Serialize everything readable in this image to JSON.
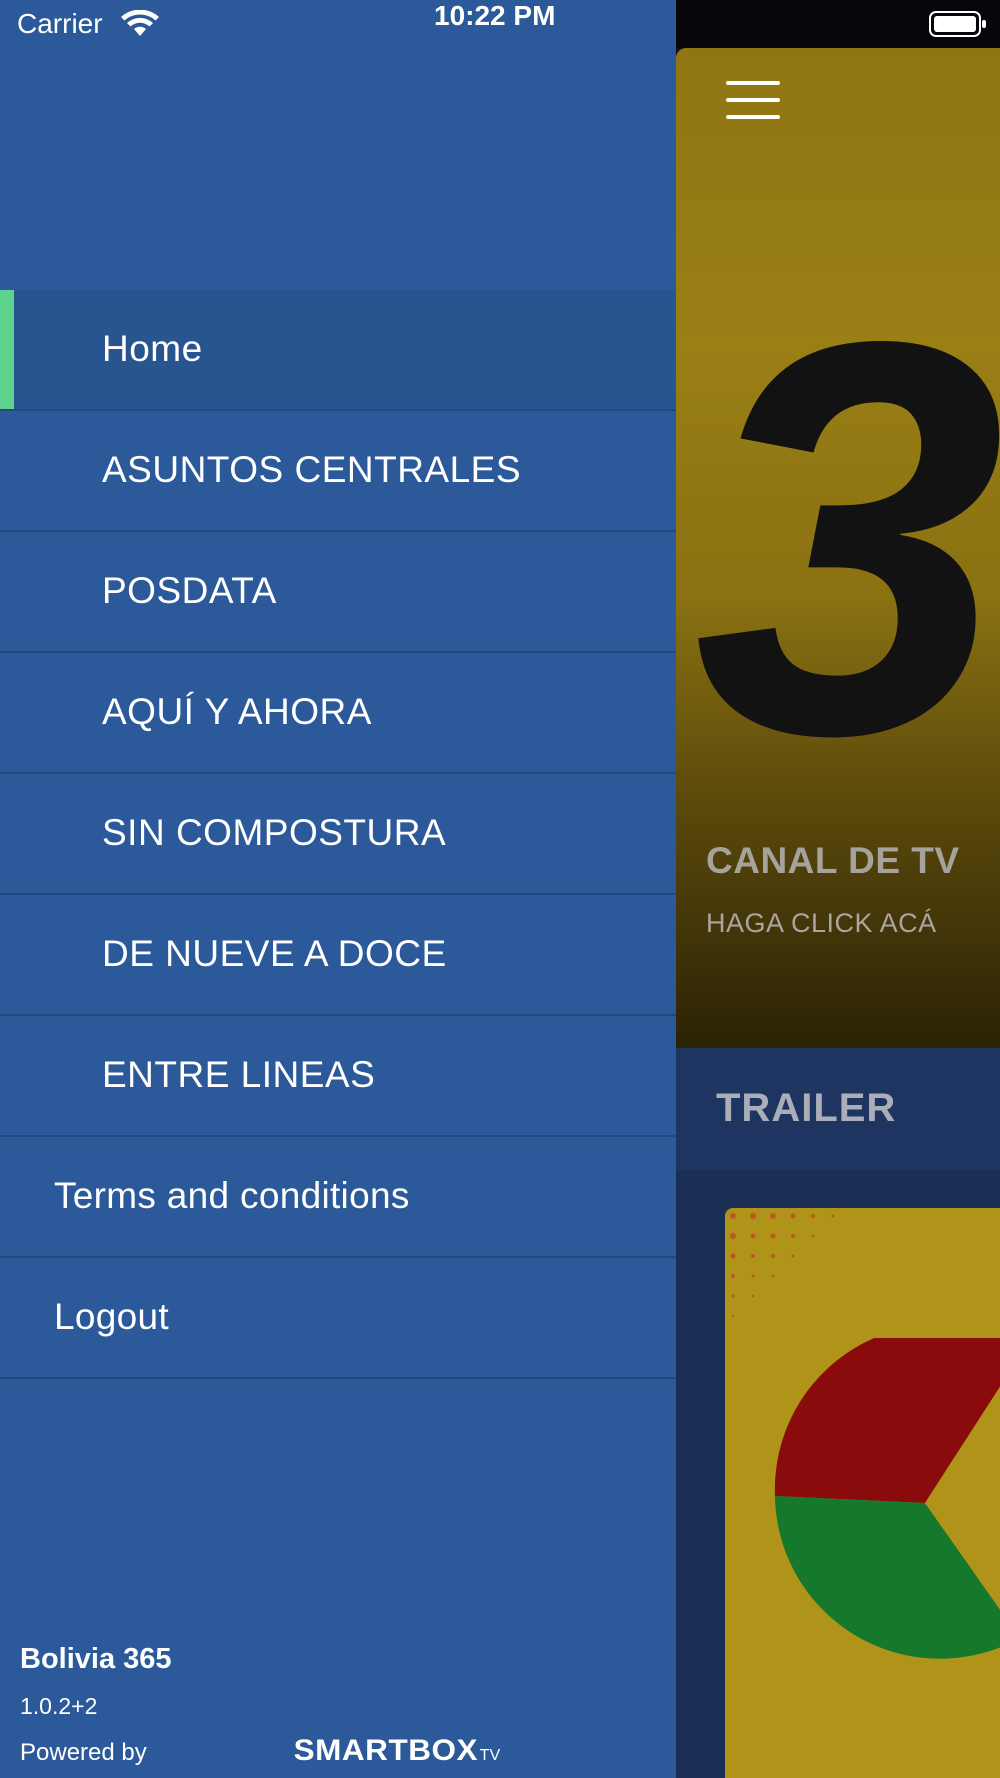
{
  "status_bar": {
    "carrier": "Carrier",
    "time": "10:22 PM"
  },
  "drawer": {
    "background_color": "#2b5999",
    "active_indicator_color": "#5fd38d",
    "menu_items": [
      {
        "label": "Home",
        "active": true
      },
      {
        "label": "ASUNTOS CENTRALES",
        "active": false
      },
      {
        "label": "POSDATA",
        "active": false
      },
      {
        "label": "AQUÍ Y AHORA",
        "active": false
      },
      {
        "label": "SIN COMPOSTURA",
        "active": false
      },
      {
        "label": "DE NUEVE A DOCE",
        "active": false
      },
      {
        "label": "ENTRE LINEAS",
        "active": false
      }
    ],
    "secondary_items": [
      {
        "label": "Terms and conditions"
      },
      {
        "label": "Logout"
      }
    ],
    "footer": {
      "app_name": "Bolivia 365",
      "version": "1.0.2+2",
      "powered_by": "Powered by",
      "brand_main": "SMARTBOX",
      "brand_suffix": "TV"
    }
  },
  "main": {
    "hero": {
      "big_digit": "3",
      "title": "CANAL DE TV",
      "subtitle": "HAGA CLICK ACÁ"
    },
    "section_title": "TRAILER",
    "icons": [
      "hamburger-menu-icon",
      "wifi-icon",
      "battery-icon"
    ]
  }
}
